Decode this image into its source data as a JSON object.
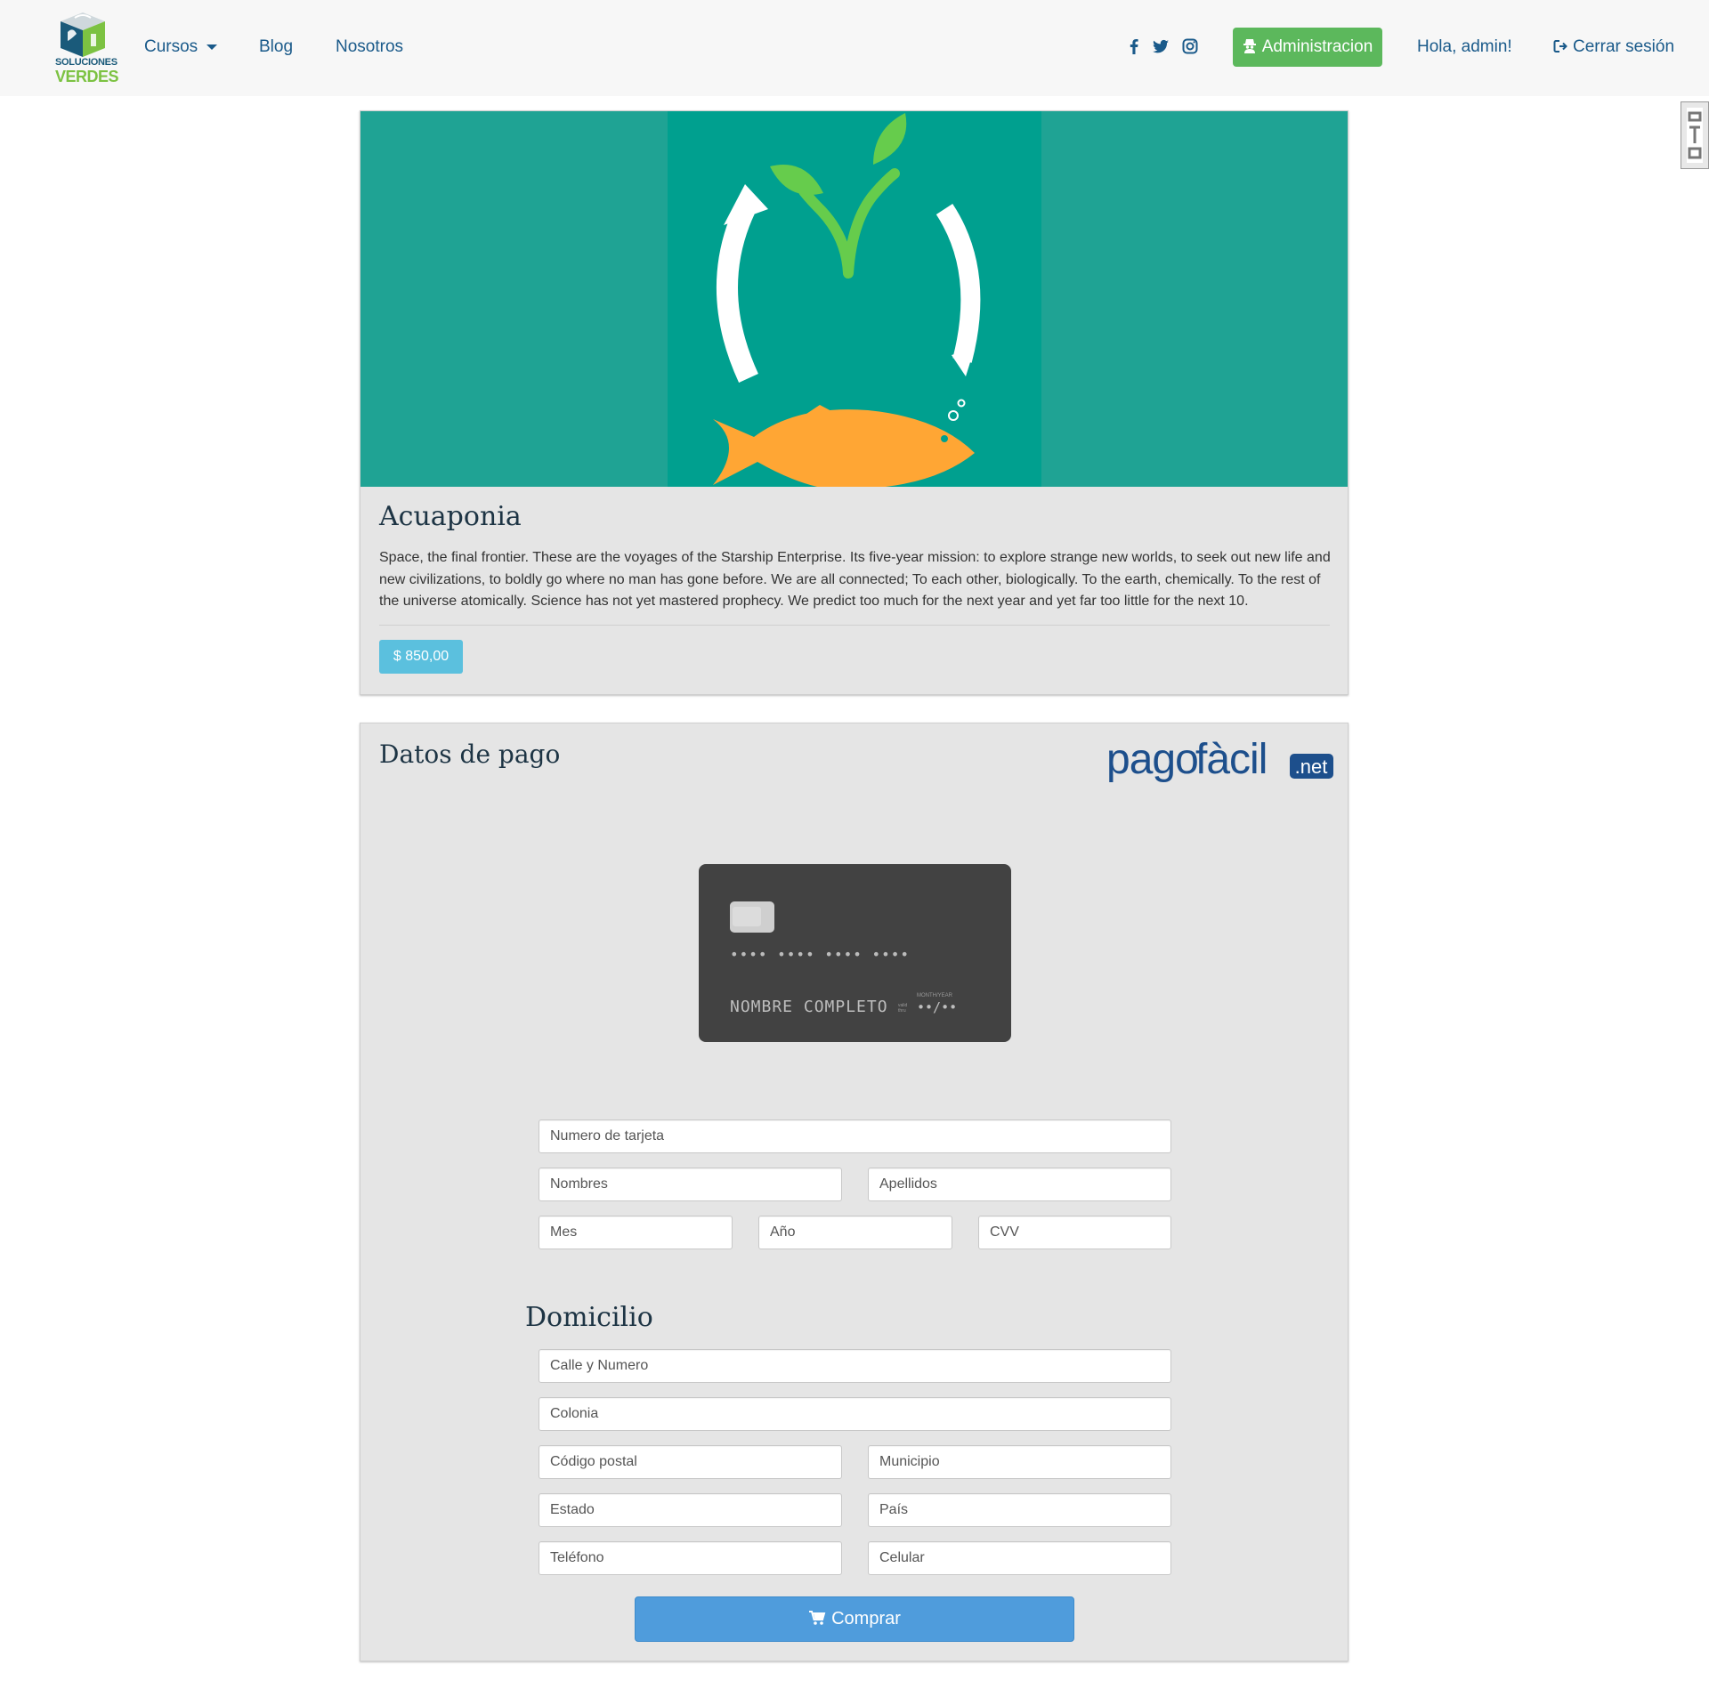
{
  "navbar": {
    "logo": {
      "line1": "SOLUCIONES",
      "line2": "VERDES"
    },
    "links": {
      "cursos": "Cursos",
      "blog": "Blog",
      "nosotros": "Nosotros"
    },
    "social_icons": [
      "facebook-icon",
      "twitter-icon",
      "instagram-icon"
    ],
    "admin_button": "Administracion",
    "greeting": "Hola, admin!",
    "logout": "Cerrar sesión"
  },
  "course": {
    "title": "Acuaponia",
    "description": "Space, the final frontier. These are the voyages of the Starship Enterprise. Its five-year mission: to explore strange new worlds, to seek out new life and new civilizations, to boldly go where no man has gone before. We are all connected; To each other, biologically. To the earth, chemically. To the rest of the universe atomically. Science has not yet mastered prophecy. We predict too much for the next year and yet far too little for the next 10.",
    "price": "$ 850,00"
  },
  "payment": {
    "title": "Datos de pago",
    "provider_logo": {
      "part1": "pago",
      "part2": "fàcil",
      "suffix": ".net"
    },
    "card_preview": {
      "number": "•••• •••• •••• ••••",
      "name": "NOMBRE COMPLETO",
      "valid_thru": "valid thru",
      "month_year": "MONTH/YEAR",
      "expiry": "••/••"
    },
    "fields": {
      "card_number": "Numero de tarjeta",
      "first_name": "Nombres",
      "last_name": "Apellidos",
      "month": "Mes",
      "year": "Año",
      "cvv": "CVV"
    }
  },
  "address": {
    "title": "Domicilio",
    "fields": {
      "street": "Calle y Numero",
      "colonia": "Colonia",
      "postal_code": "Código postal",
      "municipality": "Municipio",
      "state": "Estado",
      "country": "País",
      "phone": "Teléfono",
      "mobile": "Celular"
    }
  },
  "buy_button": "Comprar",
  "colors": {
    "navbar_bg": "#f7f7f7",
    "link": "#1a5a8a",
    "admin_green": "#5cb85c",
    "hero_teal": "#1fa394",
    "price_badge": "#5bc0de",
    "buy_blue": "#4f9cdc",
    "card_dark": "#424242"
  }
}
